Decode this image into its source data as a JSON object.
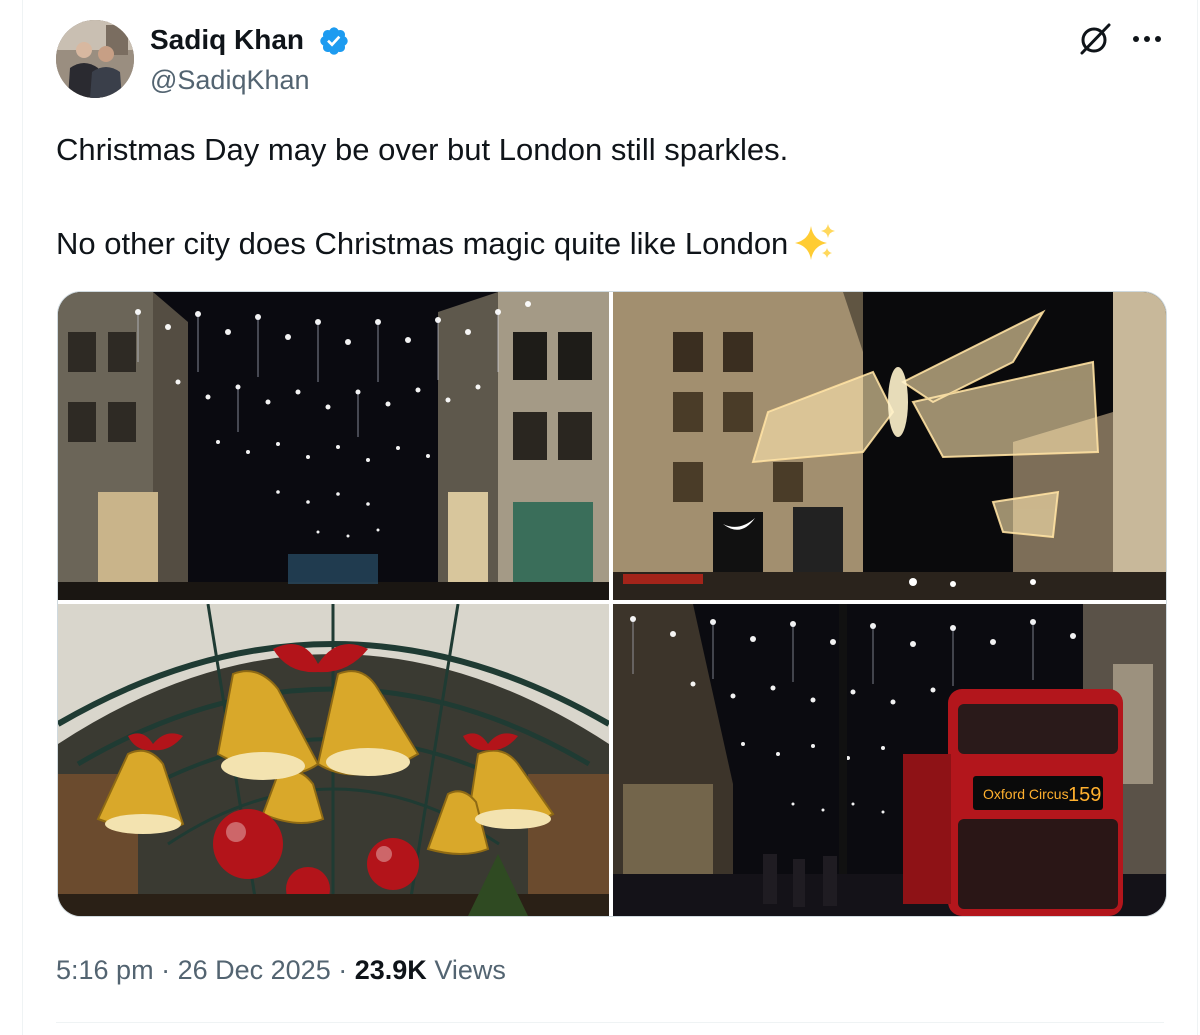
{
  "author": {
    "name": "Sadiq Khan",
    "handle": "@SadiqKhan",
    "verified": true,
    "verified_icon": "verified-badge-icon",
    "verified_color": "#1d9bf0"
  },
  "header_actions": {
    "grok_icon": "grok-icon",
    "more_icon": "more-horizontal-icon"
  },
  "tweet": {
    "line1": "Christmas Day may be over but London still sparkles.",
    "line2": "No other city does Christmas magic quite like London",
    "emoji": "sparkles"
  },
  "media": {
    "count": 4,
    "images": [
      {
        "description": "Star-shaped Christmas lights strung above a busy shopping street at night"
      },
      {
        "description": "Golden angel-wing Christmas lights over Regent Street at night"
      },
      {
        "description": "Giant golden bells with red bows and red baubles under a glass market roof"
      },
      {
        "description": "Star lights over Oxford Street with a red double-decker bus"
      }
    ],
    "bus_destination": "Oxford Circus",
    "bus_route": "159",
    "shop_sign": "NIKE"
  },
  "meta": {
    "time": "5:16 pm",
    "separator": "·",
    "date": "26 Dec 2025",
    "views_count": "23.9K",
    "views_label": "Views"
  },
  "colors": {
    "text": "#0f1419",
    "secondary": "#536471",
    "border": "#cfd9de",
    "divider": "#eff3f4"
  }
}
